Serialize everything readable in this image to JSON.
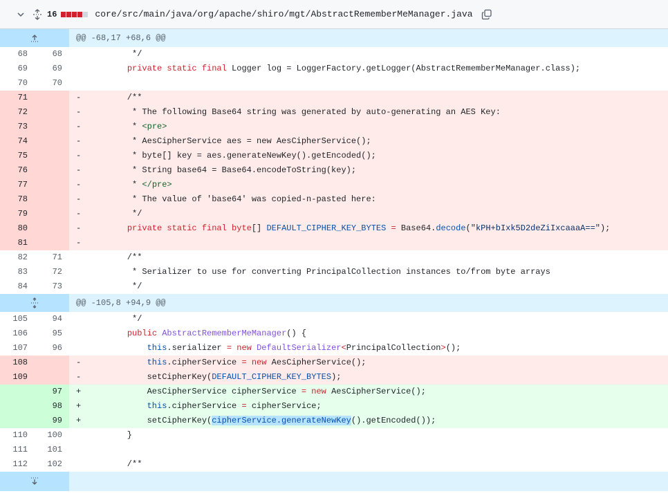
{
  "file": {
    "change_count": "16",
    "path": "core/src/main/java/org/apache/shiro/mgt/AbstractRememberMeManager.java",
    "icons": [
      "chevron-down-icon",
      "unfold-icon",
      "copy-icon"
    ]
  },
  "hunks": [
    {
      "header": "@@ -68,17 +68,6 @@"
    },
    {
      "header": "@@ -105,8 +94,9 @@"
    }
  ],
  "lines": [
    {
      "old": "68",
      "new": "68",
      "mk": "",
      "t": "ctx"
    },
    {
      "old": "69",
      "new": "69",
      "mk": "",
      "t": "ctx"
    },
    {
      "old": "70",
      "new": "70",
      "mk": "",
      "t": "ctx"
    },
    {
      "old": "71",
      "new": "",
      "mk": "-",
      "t": "del"
    },
    {
      "old": "72",
      "new": "",
      "mk": "-",
      "t": "del"
    },
    {
      "old": "73",
      "new": "",
      "mk": "-",
      "t": "del"
    },
    {
      "old": "74",
      "new": "",
      "mk": "-",
      "t": "del"
    },
    {
      "old": "75",
      "new": "",
      "mk": "-",
      "t": "del"
    },
    {
      "old": "76",
      "new": "",
      "mk": "-",
      "t": "del"
    },
    {
      "old": "77",
      "new": "",
      "mk": "-",
      "t": "del"
    },
    {
      "old": "78",
      "new": "",
      "mk": "-",
      "t": "del"
    },
    {
      "old": "79",
      "new": "",
      "mk": "-",
      "t": "del"
    },
    {
      "old": "80",
      "new": "",
      "mk": "-",
      "t": "del"
    },
    {
      "old": "81",
      "new": "",
      "mk": "-",
      "t": "del"
    },
    {
      "old": "82",
      "new": "71",
      "mk": "",
      "t": "ctx"
    },
    {
      "old": "83",
      "new": "72",
      "mk": "",
      "t": "ctx"
    },
    {
      "old": "84",
      "new": "73",
      "mk": "",
      "t": "ctx"
    },
    {
      "old": "105",
      "new": "94",
      "mk": "",
      "t": "ctx"
    },
    {
      "old": "106",
      "new": "95",
      "mk": "",
      "t": "ctx"
    },
    {
      "old": "107",
      "new": "96",
      "mk": "",
      "t": "ctx"
    },
    {
      "old": "108",
      "new": "",
      "mk": "-",
      "t": "del"
    },
    {
      "old": "109",
      "new": "",
      "mk": "-",
      "t": "del"
    },
    {
      "old": "",
      "new": "97",
      "mk": "+",
      "t": "add"
    },
    {
      "old": "",
      "new": "98",
      "mk": "+",
      "t": "add"
    },
    {
      "old": "",
      "new": "99",
      "mk": "+",
      "t": "add"
    },
    {
      "old": "110",
      "new": "100",
      "mk": "",
      "t": "ctx"
    },
    {
      "old": "111",
      "new": "101",
      "mk": "",
      "t": "ctx"
    },
    {
      "old": "112",
      "new": "102",
      "mk": "",
      "t": "ctx"
    }
  ],
  "code": {
    "l0": "     */",
    "l1_kw": "private static final",
    "l1_rest": " Logger log = LoggerFactory.getLogger(AbstractRememberMeManager.class);",
    "l2": "",
    "l3": "    /**",
    "l4": "     * The following Base64 string was generated by auto-generating an AES Key:",
    "l5_a": "     * ",
    "l5_tag": "<pre>",
    "l6": "     * AesCipherService aes = new AesCipherService();",
    "l7": "     * byte[] key = aes.generateNewKey().getEncoded();",
    "l8": "     * String base64 = Base64.encodeToString(key);",
    "l9_a": "     * ",
    "l9_tag": "</pre>",
    "l10": "     * The value of 'base64' was copied-n-pasted here:",
    "l11": "     */",
    "l12_kw": "private static final",
    "l12_kw2": "byte",
    "l12_a": "[] ",
    "l12_const": "DEFAULT_CIPHER_KEY_BYTES",
    "l12_eq": " = ",
    "l12_b": "Base64.",
    "l12_fn": "decode",
    "l12_p": "(",
    "l12_str": "\"kPH+bIxk5D2deZiIxcaaaA==\"",
    "l12_end": ");",
    "l13": "",
    "l14": "    /**",
    "l15": "     * Serializer to use for converting PrincipalCollection instances to/from byte arrays",
    "l16": "     */",
    "l17": "     */",
    "l18_kw": "public",
    "l18_fn": "AbstractRememberMeManager",
    "l18_rest": "() {",
    "l19_this": "this",
    "l19_a": ".serializer ",
    "l19_eq": "=",
    "l19_new": "new",
    "l19_cls": "DefaultSerializer",
    "l19_lt": "<",
    "l19_pc": "PrincipalCollection",
    "l19_gt": ">",
    "l19_end": "();",
    "l20_this": "this",
    "l20_a": ".cipherService ",
    "l20_eq": "=",
    "l20_new": "new",
    "l20_b": " AesCipherService();",
    "l21_a": "setCipherKey(",
    "l21_const": "DEFAULT_CIPHER_KEY_BYTES",
    "l21_end": ");",
    "l22_a": "AesCipherService cipherService ",
    "l22_eq": "=",
    "l22_new": "new",
    "l22_b": " AesCipherService();",
    "l23_this": "this",
    "l23_a": ".cipherService ",
    "l23_eq": "=",
    "l23_b": " cipherService;",
    "l24_a": "setCipherKey(",
    "l24_hl": "cipherService.generateNewKey",
    "l24_end": "().getEncoded());",
    "l25": "    }",
    "l26": "",
    "l27": "    /**"
  }
}
